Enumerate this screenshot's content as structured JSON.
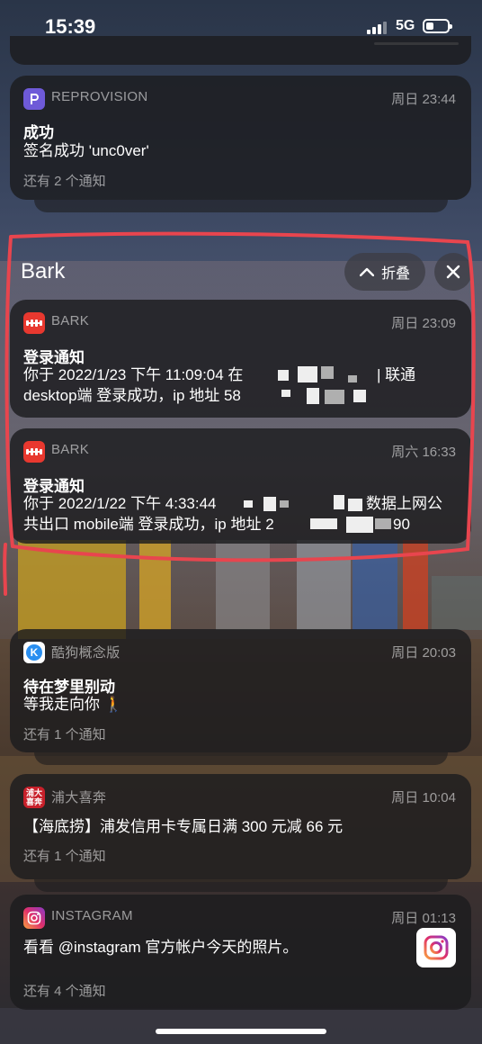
{
  "status_bar": {
    "time": "15:39",
    "network": "5G"
  },
  "group": {
    "label": "Bark",
    "collapse_label": "折叠"
  },
  "notifications": [
    {
      "id": "reprovision",
      "app": "REPROVISION",
      "time": "周日 23:44",
      "title": "成功",
      "body": "签名成功 'unc0ver'",
      "more": "还有 2 个通知"
    },
    {
      "id": "bark-1",
      "app": "BARK",
      "time": "周日 23:09",
      "title": "登录通知",
      "body_line1": "你于 2022/1/23 下午 11:09:04 在",
      "body_line1_tail": "| 联通",
      "body_line2": "desktop端 登录成功，ip 地址  58"
    },
    {
      "id": "bark-2",
      "app": "BARK",
      "time": "周六 16:33",
      "title": "登录通知",
      "body_line1": "你于 2022/1/22 下午 4:33:44",
      "body_line1_tail": "数据上网公",
      "body_line2": "共出口 mobile端 登录成功，ip 地址  2",
      "body_line2_tail": "90"
    },
    {
      "id": "kugou",
      "app": "酷狗概念版",
      "time": "周日 20:03",
      "title": "待在梦里别动",
      "body": "等我走向你 🚶",
      "more": "还有 1 个通知"
    },
    {
      "id": "spdb",
      "app": "浦大喜奔",
      "icon_text": "浦大\n喜奔",
      "time": "周日 10:04",
      "body": "【海底捞】浦发信用卡专属日满 300 元减 66 元",
      "more": "还有 1 个通知"
    },
    {
      "id": "instagram",
      "app": "INSTAGRAM",
      "time": "周日 01:13",
      "body": "看看 @instagram 官方帐户今天的照片。",
      "more": "还有 4 个通知"
    }
  ],
  "colors": {
    "bark_red": "#e8382f",
    "annotation_red": "#e8454e",
    "reprovision_purple": "#6e5ad8",
    "kugou_blue": "#2a8ff0"
  }
}
